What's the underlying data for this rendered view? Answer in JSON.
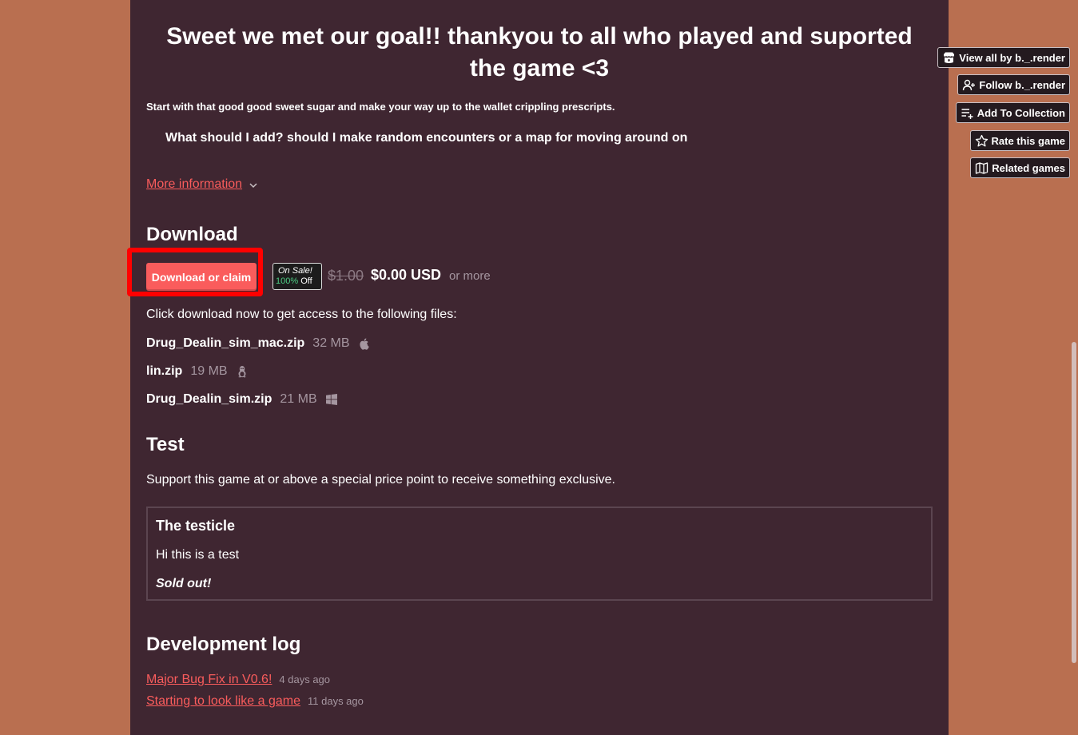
{
  "game_page": {
    "headline": "Sweet we met our goal!! thankyou to all who played and suported the game <3",
    "intro": "Start with that good good sweet sugar and make your way up to the wallet crippling prescripts.",
    "question": "What should I add? should I make random encounters or a map for moving around on",
    "more_info_link": "More information"
  },
  "download": {
    "heading": "Download",
    "button_label": "Download or claim",
    "sale_badge_line1": "On Sale!",
    "sale_badge_percent": "100%",
    "sale_badge_off": "Off",
    "original_price": "$1.00",
    "price": "$0.00 USD",
    "or_more": "or more",
    "access_text": "Click download now to get access to the following files:",
    "files": [
      {
        "name": "Drug_Dealin_sim_mac.zip",
        "size": "32 MB",
        "platform_icon": "apple-icon"
      },
      {
        "name": "lin.zip",
        "size": "19 MB",
        "platform_icon": "linux-icon"
      },
      {
        "name": "Drug_Dealin_sim.zip",
        "size": "21 MB",
        "platform_icon": "windows-icon"
      }
    ]
  },
  "reward_section": {
    "heading": "Test",
    "support_text": "Support this game at or above a special price point to receive something exclusive.",
    "reward": {
      "title": "The testicle",
      "description": "Hi this is a test",
      "status": "Sold out!"
    }
  },
  "devlog": {
    "heading": "Development log",
    "posts": [
      {
        "title": "Major Bug Fix in V0.6!",
        "date": "4 days ago"
      },
      {
        "title": "Starting to look like a game",
        "date": "11 days ago"
      }
    ]
  },
  "sidebar": {
    "buttons": [
      {
        "label": "View all by b._.render",
        "icon": "itchio-icon"
      },
      {
        "label": "Follow b._.render",
        "icon": "user-plus-icon"
      },
      {
        "label": "Add To Collection",
        "icon": "add-list-icon"
      },
      {
        "label": "Rate this game",
        "icon": "star-icon"
      },
      {
        "label": "Related games",
        "icon": "map-icon"
      }
    ]
  },
  "colors": {
    "background": "#b96f50",
    "page": "#3f2631",
    "accent": "#fa5c5c",
    "sale_green": "#4ecf85",
    "highlight": "#ff0000"
  }
}
